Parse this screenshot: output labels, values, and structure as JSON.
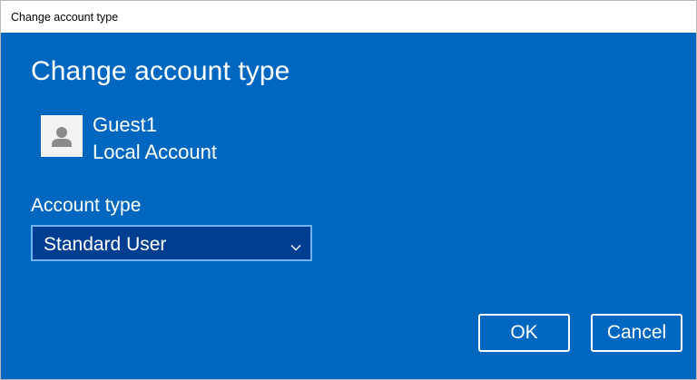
{
  "window": {
    "title": "Change account type"
  },
  "dialog": {
    "heading": "Change account type",
    "account": {
      "name": "Guest1",
      "type": "Local Account",
      "avatar_icon": "user-avatar-icon"
    },
    "account_type_label": "Account type",
    "account_type_select": {
      "selected": "Standard User",
      "icon": "chevron-down-icon"
    },
    "buttons": {
      "ok": "OK",
      "cancel": "Cancel"
    }
  },
  "colors": {
    "background": "#0067c0",
    "select_background": "#003e92",
    "select_border": "#6fb3ee",
    "text": "#ffffff"
  }
}
